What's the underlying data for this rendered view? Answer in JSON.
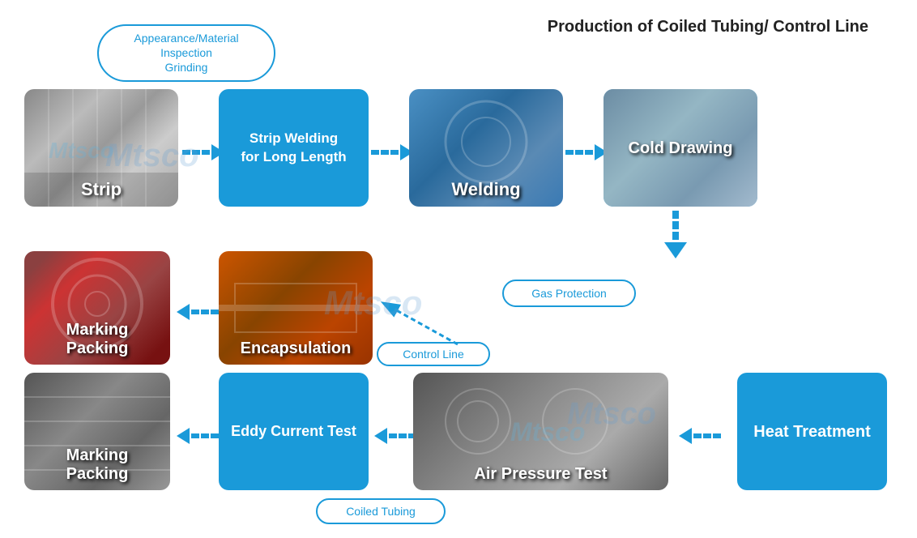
{
  "title": "Production of Coiled Tubing/ Control Line",
  "oval_inspection": "Appearance/Material Inspection\nGrinding",
  "oval_gas": "Gas Protection",
  "oval_control_line": "Control Line",
  "oval_coiled_tubing": "Coiled Tubing",
  "watermark1": "Mtsco",
  "watermark2": "Mtsco",
  "watermark3": "Mtsco",
  "boxes": {
    "strip_welding": "Strip Welding\nfor Long Length",
    "cold_drawing": "Cold Drawing",
    "encapsulation": "Encapsulation",
    "eddy_current": "Eddy Current Test",
    "heat_treatment": "Heat Treatment"
  },
  "photos": {
    "strip": "Strip",
    "welding": "Welding",
    "marking_packing_1": "Marking\nPacking",
    "marking_packing_2": "Marking\nPacking",
    "air_pressure": "Air Pressure Test"
  }
}
